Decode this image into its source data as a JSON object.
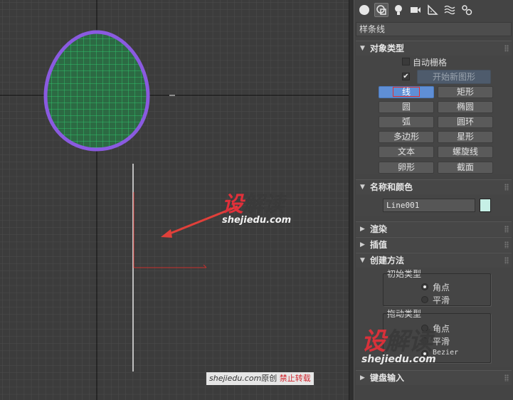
{
  "tabs": [
    {
      "icon": "create-geometry-icon"
    },
    {
      "icon": "create-shapes-icon",
      "active": true
    },
    {
      "icon": "create-lights-icon"
    },
    {
      "icon": "create-cameras-icon"
    },
    {
      "icon": "create-helpers-icon"
    },
    {
      "icon": "create-spacewarps-icon"
    },
    {
      "icon": "create-systems-icon"
    }
  ],
  "category_dropdown": "样条线",
  "object_type": {
    "title": "对象类型",
    "autogrid_label": "自动栅格",
    "start_new_shape_label": "开始新图形",
    "start_new_shape_checked": "✔",
    "buttons": [
      {
        "label": "线",
        "active": true
      },
      {
        "label": "矩形"
      },
      {
        "label": "圆"
      },
      {
        "label": "椭圆"
      },
      {
        "label": "弧"
      },
      {
        "label": "圆环"
      },
      {
        "label": "多边形"
      },
      {
        "label": "星形"
      },
      {
        "label": "文本"
      },
      {
        "label": "螺旋线"
      },
      {
        "label": "卵形"
      },
      {
        "label": "截面"
      }
    ]
  },
  "name_color": {
    "title": "名称和颜色",
    "name_value": "Line001",
    "swatch_color": "#c6f0e6"
  },
  "rollouts": {
    "rendering": "渲染",
    "interpolation": "插值",
    "creation_method": "创建方法",
    "keyboard_entry": "键盘输入"
  },
  "creation_method": {
    "initial_type": {
      "title": "初始类型",
      "options": [
        {
          "label": "角点",
          "selected": true
        },
        {
          "label": "平滑",
          "selected": false
        }
      ]
    },
    "drag_type": {
      "title": "拖动类型",
      "options": [
        {
          "label": "角点",
          "selected": false
        },
        {
          "label": "平滑",
          "selected": false
        },
        {
          "label": "Bezier",
          "selected": true
        }
      ]
    }
  },
  "watermark": {
    "brand_red": "设",
    "brand_dark": "解读",
    "url": "shejiedu.com",
    "credit_site": "shejiedu.com",
    "credit_text": "原创",
    "credit_warning": "禁止转载"
  },
  "colors": {
    "egg_outline": "#8a5ae0",
    "egg_grid": "#2fbf6a",
    "active_button": "#5f8fd6",
    "construction_line": "#c9302c",
    "arrow": "#e0403a"
  }
}
